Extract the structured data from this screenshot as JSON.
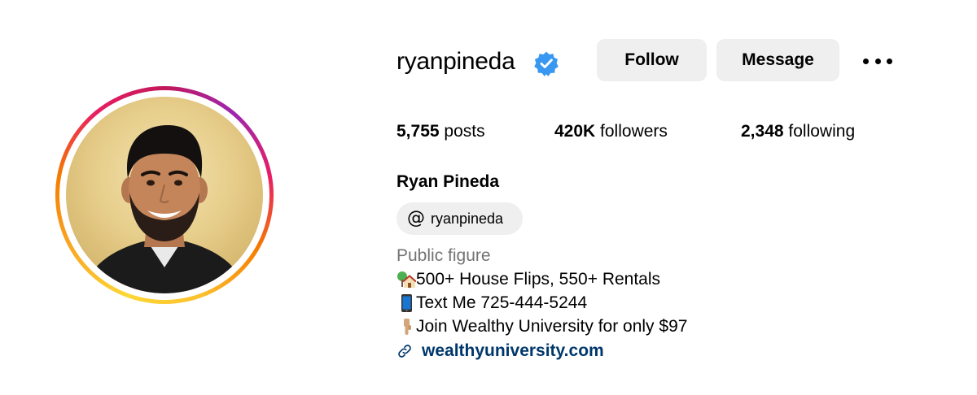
{
  "profile": {
    "username": "ryanpineda",
    "full_name": "Ryan Pineda",
    "category": "Public figure",
    "verified": true
  },
  "actions": {
    "follow_label": "Follow",
    "message_label": "Message"
  },
  "stats": {
    "posts_count": "5,755",
    "posts_label": "posts",
    "followers_count": "420K",
    "followers_label": "followers",
    "following_count": "2,348",
    "following_label": "following"
  },
  "threads": {
    "handle": "ryanpineda",
    "icon": "threads-icon"
  },
  "bio": {
    "line1": "500+ House Flips, 550+ Rentals",
    "line1_icon": "house-tree-emoji",
    "line2": "Text Me 725-444-5244",
    "line2_icon": "mobile-phone-emoji",
    "line3": " Join Wealthy University for only $97",
    "line3_icon": "pointing-down-emoji",
    "link": "wealthyuniversity.com",
    "link_icon": "link-icon"
  },
  "colors": {
    "verified": "#3897f0",
    "link": "#00376b",
    "secondary_text": "#737373",
    "button_bg": "#efefef"
  }
}
